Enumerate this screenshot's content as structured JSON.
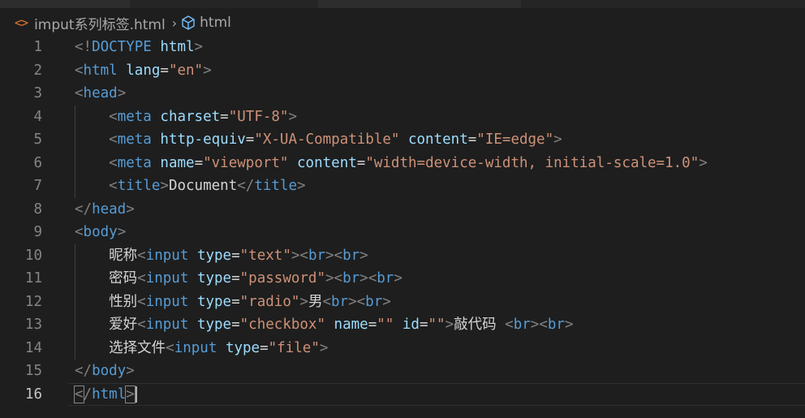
{
  "breadcrumb": {
    "file_icon": "<>",
    "file_name": "imput系列标签.html",
    "separator": "›",
    "symbol_icon": "cube-icon",
    "symbol_name": "html"
  },
  "code_lines": [
    {
      "num": "1",
      "tokens": [
        [
          "br",
          "<!"
        ],
        [
          "tag",
          "DOCTYPE"
        ],
        [
          "txt",
          " "
        ],
        [
          "attr",
          "html"
        ],
        [
          "br",
          ">"
        ]
      ]
    },
    {
      "num": "2",
      "tokens": [
        [
          "br",
          "<"
        ],
        [
          "tag",
          "html"
        ],
        [
          "txt",
          " "
        ],
        [
          "attr",
          "lang"
        ],
        [
          "txt",
          "="
        ],
        [
          "val",
          "\"en\""
        ],
        [
          "br",
          ">"
        ]
      ]
    },
    {
      "num": "3",
      "tokens": [
        [
          "br",
          "<"
        ],
        [
          "tag",
          "head"
        ],
        [
          "br",
          ">"
        ]
      ]
    },
    {
      "num": "4",
      "indent": true,
      "tokens": [
        [
          "txt",
          "    "
        ],
        [
          "br",
          "<"
        ],
        [
          "tag",
          "meta"
        ],
        [
          "txt",
          " "
        ],
        [
          "attr",
          "charset"
        ],
        [
          "txt",
          "="
        ],
        [
          "val",
          "\"UTF-8\""
        ],
        [
          "br",
          ">"
        ]
      ]
    },
    {
      "num": "5",
      "indent": true,
      "tokens": [
        [
          "txt",
          "    "
        ],
        [
          "br",
          "<"
        ],
        [
          "tag",
          "meta"
        ],
        [
          "txt",
          " "
        ],
        [
          "attr",
          "http-equiv"
        ],
        [
          "txt",
          "="
        ],
        [
          "val",
          "\"X-UA-Compatible\""
        ],
        [
          "txt",
          " "
        ],
        [
          "attr",
          "content"
        ],
        [
          "txt",
          "="
        ],
        [
          "val",
          "\"IE=edge\""
        ],
        [
          "br",
          ">"
        ]
      ]
    },
    {
      "num": "6",
      "indent": true,
      "tokens": [
        [
          "txt",
          "    "
        ],
        [
          "br",
          "<"
        ],
        [
          "tag",
          "meta"
        ],
        [
          "txt",
          " "
        ],
        [
          "attr",
          "name"
        ],
        [
          "txt",
          "="
        ],
        [
          "val",
          "\"viewport\""
        ],
        [
          "txt",
          " "
        ],
        [
          "attr",
          "content"
        ],
        [
          "txt",
          "="
        ],
        [
          "val",
          "\"width=device-width, initial-scale=1.0\""
        ],
        [
          "br",
          ">"
        ]
      ]
    },
    {
      "num": "7",
      "indent": true,
      "tokens": [
        [
          "txt",
          "    "
        ],
        [
          "br",
          "<"
        ],
        [
          "tag",
          "title"
        ],
        [
          "br",
          ">"
        ],
        [
          "txt",
          "Document"
        ],
        [
          "br",
          "</"
        ],
        [
          "tag",
          "title"
        ],
        [
          "br",
          ">"
        ]
      ]
    },
    {
      "num": "8",
      "tokens": [
        [
          "br",
          "</"
        ],
        [
          "tag",
          "head"
        ],
        [
          "br",
          ">"
        ]
      ]
    },
    {
      "num": "9",
      "tokens": [
        [
          "br",
          "<"
        ],
        [
          "tag",
          "body"
        ],
        [
          "br",
          ">"
        ]
      ]
    },
    {
      "num": "10",
      "indent": true,
      "tokens": [
        [
          "txt",
          "    昵称"
        ],
        [
          "br",
          "<"
        ],
        [
          "tag",
          "input"
        ],
        [
          "txt",
          " "
        ],
        [
          "attr",
          "type"
        ],
        [
          "txt",
          "="
        ],
        [
          "val",
          "\"text\""
        ],
        [
          "br",
          "><"
        ],
        [
          "tag",
          "br"
        ],
        [
          "br",
          "><"
        ],
        [
          "tag",
          "br"
        ],
        [
          "br",
          ">"
        ]
      ]
    },
    {
      "num": "11",
      "indent": true,
      "tokens": [
        [
          "txt",
          "    密码"
        ],
        [
          "br",
          "<"
        ],
        [
          "tag",
          "input"
        ],
        [
          "txt",
          " "
        ],
        [
          "attr",
          "type"
        ],
        [
          "txt",
          "="
        ],
        [
          "val",
          "\"password\""
        ],
        [
          "br",
          "><"
        ],
        [
          "tag",
          "br"
        ],
        [
          "br",
          "><"
        ],
        [
          "tag",
          "br"
        ],
        [
          "br",
          ">"
        ]
      ]
    },
    {
      "num": "12",
      "indent": true,
      "tokens": [
        [
          "txt",
          "    性别"
        ],
        [
          "br",
          "<"
        ],
        [
          "tag",
          "input"
        ],
        [
          "txt",
          " "
        ],
        [
          "attr",
          "type"
        ],
        [
          "txt",
          "="
        ],
        [
          "val",
          "\"radio\""
        ],
        [
          "br",
          ">"
        ],
        [
          "txt",
          "男"
        ],
        [
          "br",
          "<"
        ],
        [
          "tag",
          "br"
        ],
        [
          "br",
          "><"
        ],
        [
          "tag",
          "br"
        ],
        [
          "br",
          ">"
        ]
      ]
    },
    {
      "num": "13",
      "indent": true,
      "tokens": [
        [
          "txt",
          "    爱好"
        ],
        [
          "br",
          "<"
        ],
        [
          "tag",
          "input"
        ],
        [
          "txt",
          " "
        ],
        [
          "attr",
          "type"
        ],
        [
          "txt",
          "="
        ],
        [
          "val",
          "\"checkbox\""
        ],
        [
          "txt",
          " "
        ],
        [
          "attr",
          "name"
        ],
        [
          "txt",
          "="
        ],
        [
          "val",
          "\"\""
        ],
        [
          "txt",
          " "
        ],
        [
          "attr",
          "id"
        ],
        [
          "txt",
          "="
        ],
        [
          "val",
          "\"\""
        ],
        [
          "br",
          ">"
        ],
        [
          "txt",
          "敲代码 "
        ],
        [
          "br",
          "<"
        ],
        [
          "tag",
          "br"
        ],
        [
          "br",
          "><"
        ],
        [
          "tag",
          "br"
        ],
        [
          "br",
          ">"
        ]
      ]
    },
    {
      "num": "14",
      "indent": true,
      "tokens": [
        [
          "txt",
          "    选择文件"
        ],
        [
          "br",
          "<"
        ],
        [
          "tag",
          "input"
        ],
        [
          "txt",
          " "
        ],
        [
          "attr",
          "type"
        ],
        [
          "txt",
          "="
        ],
        [
          "val",
          "\"file\""
        ],
        [
          "br",
          ">"
        ]
      ]
    },
    {
      "num": "15",
      "tokens": [
        [
          "br",
          "</"
        ],
        [
          "tag",
          "body"
        ],
        [
          "br",
          ">"
        ]
      ]
    },
    {
      "num": "16",
      "active": true,
      "tokens": [
        [
          "boxbr",
          "<"
        ],
        [
          "br",
          "/"
        ],
        [
          "tag",
          "html"
        ],
        [
          "boxbr",
          ">"
        ],
        [
          "cursor",
          ""
        ]
      ]
    }
  ],
  "colors": {
    "background": "#1e1e1e",
    "bracket": "#808080",
    "tag": "#569cd6",
    "attribute": "#9cdcfe",
    "string": "#ce9178",
    "text": "#d4d4d4",
    "line_number": "#858585",
    "file_icon": "#e37933"
  }
}
